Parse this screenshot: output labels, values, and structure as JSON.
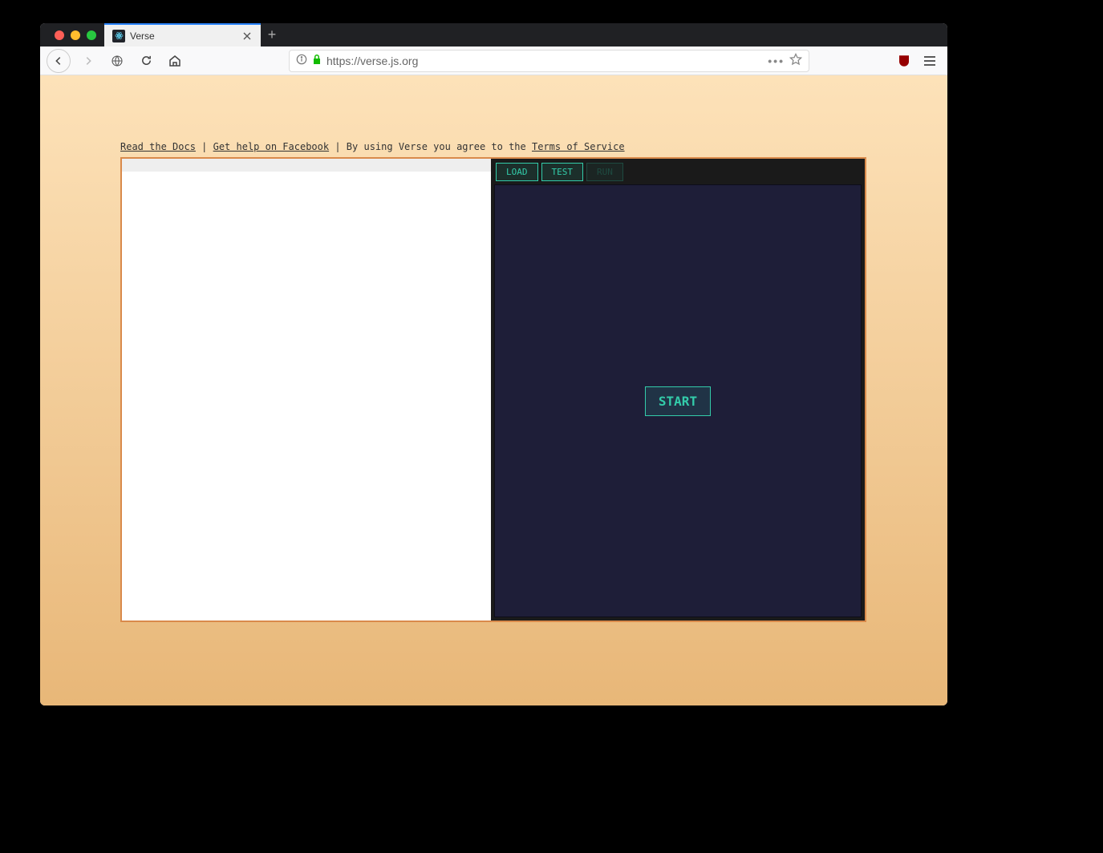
{
  "browser": {
    "tab_title": "Verse",
    "url": "https://verse.js.org"
  },
  "page": {
    "links": {
      "docs": "Read the Docs",
      "sep1": " | ",
      "facebook": "Get help on Facebook",
      "sep2": " | ",
      "agree_text": "By using Verse you agree to the ",
      "terms": "Terms of Service"
    },
    "toolbar": {
      "load": "LOAD",
      "test": "TEST",
      "run": "RUN"
    },
    "canvas": {
      "start": "START"
    }
  }
}
